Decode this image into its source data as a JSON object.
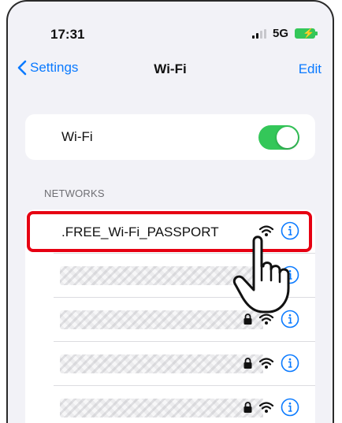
{
  "status_bar": {
    "time": "17:31",
    "network": "5G"
  },
  "nav": {
    "back_label": "Settings",
    "title": "Wi-Fi",
    "edit_label": "Edit"
  },
  "wifi": {
    "label": "Wi-Fi",
    "enabled": true
  },
  "networks": {
    "header": "NETWORKS",
    "items": [
      {
        "name": ".FREE_Wi-Fi_PASSPORT",
        "locked": false
      },
      {
        "name": "",
        "locked": false
      },
      {
        "name": "",
        "locked": true
      },
      {
        "name": "",
        "locked": true
      },
      {
        "name": "",
        "locked": true
      }
    ]
  },
  "colors": {
    "accent": "#0a7aff",
    "toggle_on": "#34c759",
    "highlight": "#e60012",
    "background": "#f2f2f7"
  },
  "icons": [
    "chevron-left-icon",
    "wifi-signal-icon",
    "lock-icon",
    "info-icon",
    "pointing-hand-icon",
    "battery-icon",
    "cellular-signal-icon"
  ]
}
